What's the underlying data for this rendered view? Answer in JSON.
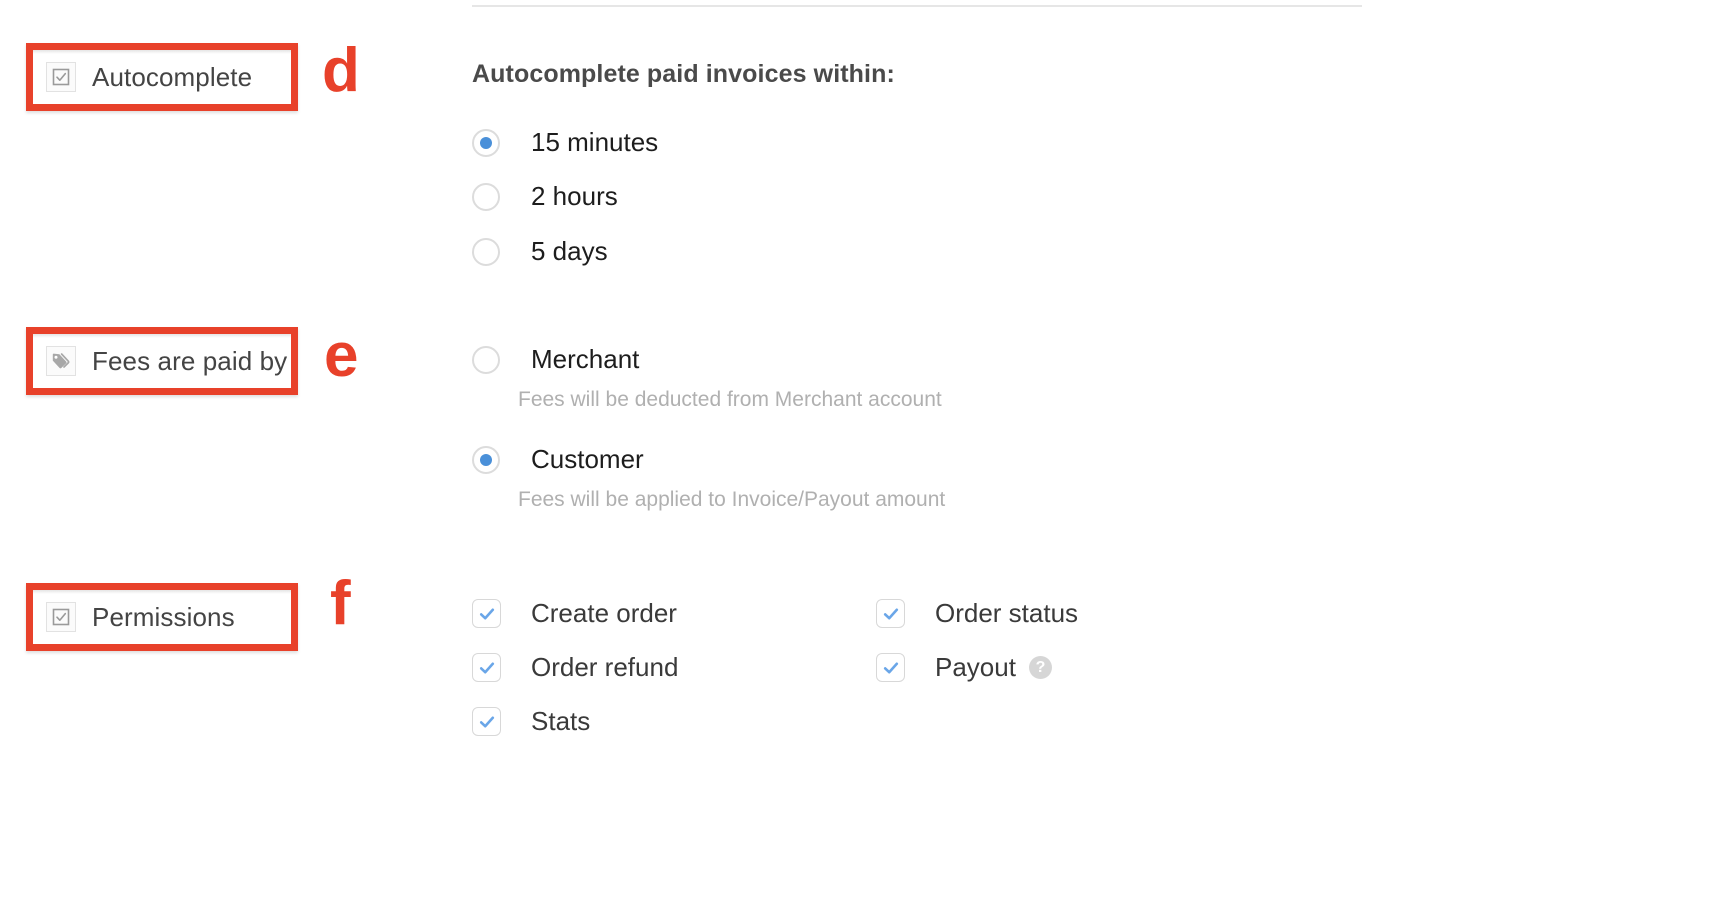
{
  "annotations": {
    "letter_d": "d",
    "letter_e": "e",
    "letter_f": "f",
    "color": "#e8412a"
  },
  "left_labels": [
    {
      "id": "autocomplete",
      "text": "Autocomplete",
      "icon": "checkbox-square-icon"
    },
    {
      "id": "fees_paid_by",
      "text": "Fees are paid by",
      "icon": "tag-icon"
    },
    {
      "id": "permissions",
      "text": "Permissions",
      "icon": "checkbox-square-icon"
    }
  ],
  "autocomplete": {
    "heading": "Autocomplete paid invoices within:",
    "options": [
      {
        "label": "15 minutes",
        "selected": true
      },
      {
        "label": "2 hours",
        "selected": false
      },
      {
        "label": "5 days",
        "selected": false
      }
    ]
  },
  "fees": {
    "options": [
      {
        "label": "Merchant",
        "selected": false,
        "note": "Fees will be deducted from Merchant account"
      },
      {
        "label": "Customer",
        "selected": true,
        "note": "Fees will be applied to Invoice/Payout amount"
      }
    ]
  },
  "permissions": {
    "items": [
      {
        "label": "Create order",
        "checked": true,
        "help": false
      },
      {
        "label": "Order refund",
        "checked": true,
        "help": false
      },
      {
        "label": "Stats",
        "checked": true,
        "help": false
      },
      {
        "label": "Order status",
        "checked": true,
        "help": false
      },
      {
        "label": "Payout",
        "checked": true,
        "help": true,
        "help_glyph": "?"
      }
    ]
  },
  "colors": {
    "accent_red": "#e8412a",
    "radio_blue": "#4a90d9",
    "check_blue": "#6aa6e8",
    "text_dark": "#1d1d1d",
    "text_muted": "#b0b0b0"
  }
}
